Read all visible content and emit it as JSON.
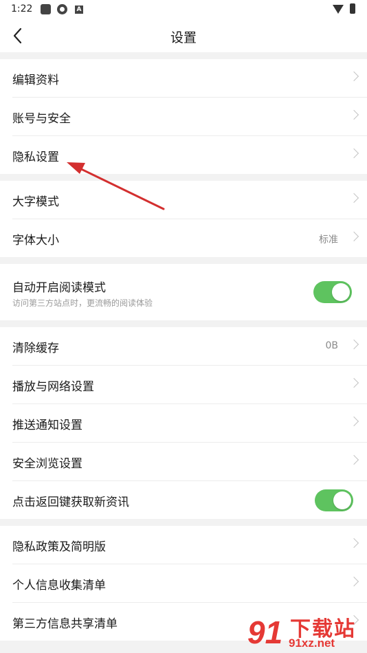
{
  "status_bar": {
    "time": "1:22",
    "icons": [
      "app-square-icon",
      "aperture-icon",
      "a-badge-icon",
      "wifi-icon",
      "battery-icon"
    ]
  },
  "nav": {
    "title": "设置",
    "back_icon": "chevron-left-icon"
  },
  "groups": [
    {
      "items": [
        {
          "label": "编辑资料"
        },
        {
          "label": "账号与安全"
        },
        {
          "label": "隐私设置"
        }
      ]
    },
    {
      "items": [
        {
          "label": "大字模式"
        },
        {
          "label": "字体大小",
          "value": "标准"
        }
      ]
    },
    {
      "items": [
        {
          "label": "自动开启阅读模式",
          "sub": "访问第三方站点时，更流畅的阅读体验",
          "toggle": true
        }
      ]
    },
    {
      "items": [
        {
          "label": "清除缓存",
          "value": "0B"
        },
        {
          "label": "播放与网络设置"
        },
        {
          "label": "推送通知设置"
        },
        {
          "label": "安全浏览设置"
        },
        {
          "label": "点击返回键获取新资讯",
          "toggle": true
        }
      ]
    },
    {
      "items": [
        {
          "label": "隐私政策及简明版"
        },
        {
          "label": "个人信息收集清单"
        },
        {
          "label": "第三方信息共享清单"
        }
      ]
    }
  ],
  "annotation": {
    "type": "red-arrow",
    "target": "隐私设置"
  },
  "watermark": {
    "top": "下载站",
    "bottom": "91xz.net"
  },
  "colors": {
    "toggle_on": "#5ec35f",
    "arrow": "#d32f2f",
    "watermark": "#e53935",
    "background": "#f2f2f2"
  }
}
